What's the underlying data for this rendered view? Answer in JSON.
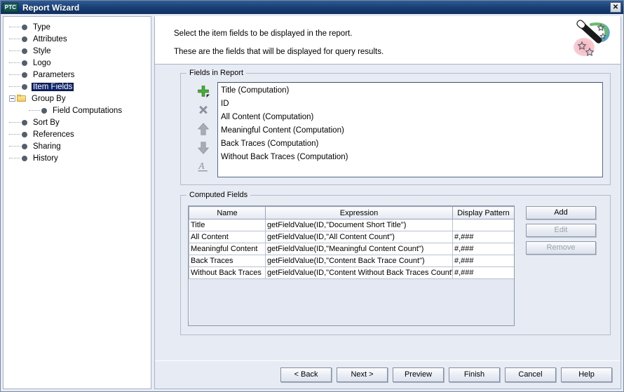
{
  "window": {
    "logo_text": "PTC",
    "title": "Report Wizard",
    "close_label": "✕"
  },
  "sidebar": {
    "items": [
      {
        "label": "Type",
        "icon": "bullet-icon",
        "indent": 1,
        "selected": false
      },
      {
        "label": "Attributes",
        "icon": "bullet-icon",
        "indent": 1,
        "selected": false
      },
      {
        "label": "Style",
        "icon": "bullet-icon",
        "indent": 1,
        "selected": false
      },
      {
        "label": "Logo",
        "icon": "bullet-icon",
        "indent": 1,
        "selected": false
      },
      {
        "label": "Parameters",
        "icon": "bullet-icon",
        "indent": 1,
        "selected": false
      },
      {
        "label": "Item Fields",
        "icon": "bullet-icon",
        "indent": 1,
        "selected": true
      },
      {
        "label": "Group By",
        "icon": "folder-icon",
        "indent": 1,
        "selected": false,
        "expander": "minus"
      },
      {
        "label": "Field Computations",
        "icon": "bullet-icon",
        "indent": 2,
        "selected": false
      },
      {
        "label": "Sort By",
        "icon": "bullet-icon",
        "indent": 1,
        "selected": false
      },
      {
        "label": "References",
        "icon": "bullet-icon",
        "indent": 1,
        "selected": false
      },
      {
        "label": "Sharing",
        "icon": "bullet-icon",
        "indent": 1,
        "selected": false
      },
      {
        "label": "History",
        "icon": "bullet-icon",
        "indent": 1,
        "selected": false
      }
    ]
  },
  "header": {
    "line1": "Select the item fields to be displayed in the report.",
    "line2": "These are the fields that will be displayed for query results.",
    "icon": "magic-wand-icon"
  },
  "fields_in_report": {
    "title": "Fields in Report",
    "tools": [
      {
        "name": "add-field-icon",
        "glyph": "+"
      },
      {
        "name": "remove-field-icon",
        "glyph": "✕"
      },
      {
        "name": "move-up-icon",
        "glyph": "↑"
      },
      {
        "name": "move-down-icon",
        "glyph": "↓"
      },
      {
        "name": "rename-field-icon",
        "glyph": "A"
      }
    ],
    "items": [
      "Title (Computation)",
      "ID",
      "All Content (Computation)",
      "Meaningful Content (Computation)",
      "Back Traces (Computation)",
      "Without Back Traces (Computation)"
    ]
  },
  "computed_fields": {
    "title": "Computed Fields",
    "columns": [
      "Name",
      "Expression",
      "Display Pattern"
    ],
    "rows": [
      {
        "name": "Title",
        "expression": "getFieldValue(ID,\"Document Short Title\")",
        "display_pattern": ""
      },
      {
        "name": "All Content",
        "expression": "getFieldValue(ID,\"All Content Count\")",
        "display_pattern": "#,###"
      },
      {
        "name": "Meaningful Content",
        "expression": "getFieldValue(ID,\"Meaningful Content Count\")",
        "display_pattern": "#,###"
      },
      {
        "name": "Back Traces",
        "expression": "getFieldValue(ID,\"Content Back Trace Count\")",
        "display_pattern": "#,###"
      },
      {
        "name": "Without Back Traces",
        "expression": "getFieldValue(ID,\"Content Without Back Traces Count\")",
        "display_pattern": "#,###"
      }
    ],
    "buttons": [
      {
        "label": "Add",
        "enabled": true
      },
      {
        "label": "Edit",
        "enabled": false
      },
      {
        "label": "Remove",
        "enabled": false
      }
    ]
  },
  "footer": {
    "buttons": [
      {
        "label": "< Back"
      },
      {
        "label": "Next >"
      },
      {
        "label": "Preview"
      },
      {
        "label": "Finish"
      },
      {
        "label": "Cancel"
      },
      {
        "label": "Help"
      }
    ]
  }
}
